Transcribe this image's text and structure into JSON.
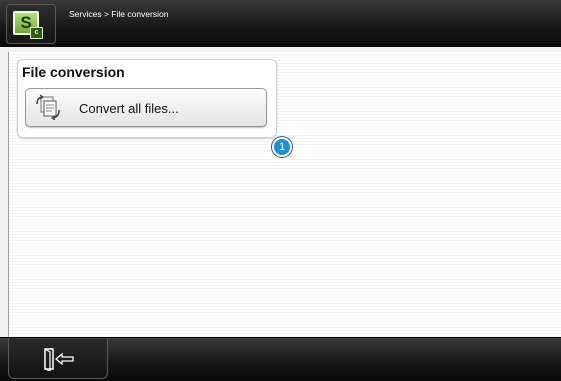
{
  "header": {
    "breadcrumb": "Services > File conversion",
    "app_icon": "app-logo-icon",
    "app_logo_letter": "S"
  },
  "group": {
    "title": "File conversion",
    "convert_button_label": "Convert all files...",
    "convert_icon": "file-convert-icon"
  },
  "callout": {
    "number": "1"
  },
  "footer": {
    "exit_icon": "exit-door-icon"
  },
  "colors": {
    "bar_background": "#161616",
    "content_background": "#ffffff",
    "callout": "#1e8fd6",
    "logo_green": "#8ec653"
  }
}
